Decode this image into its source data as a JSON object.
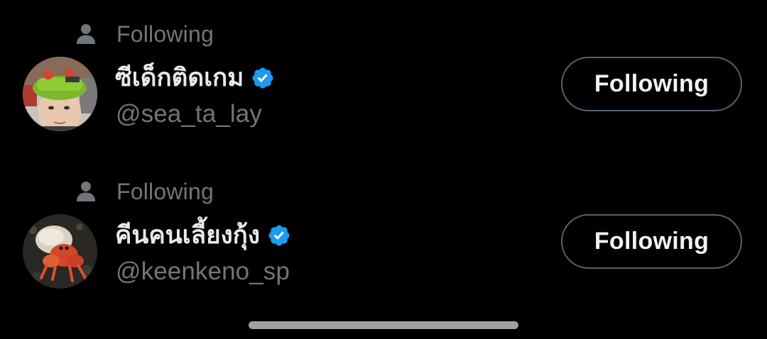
{
  "users": [
    {
      "context_label": "Following",
      "display_name": "ซีเด็กติดเกม",
      "handle": "@sea_ta_lay",
      "verified": true,
      "button_label": "Following",
      "avatar_description_icon": "avatar-green-hat"
    },
    {
      "context_label": "Following",
      "display_name": "คีนคนเลี้ยงกุ้ง",
      "handle": "@keenkeno_sp",
      "verified": true,
      "button_label": "Following",
      "avatar_description_icon": "avatar-hermit-crab"
    }
  ],
  "colors": {
    "background": "#000000",
    "primary_text": "#e7e9ea",
    "secondary_text": "#71767b",
    "verified_blue": "#1d9bf0",
    "button_border": "#536471"
  },
  "icons": {
    "context": "person-icon",
    "verified": "verified-badge-icon"
  }
}
